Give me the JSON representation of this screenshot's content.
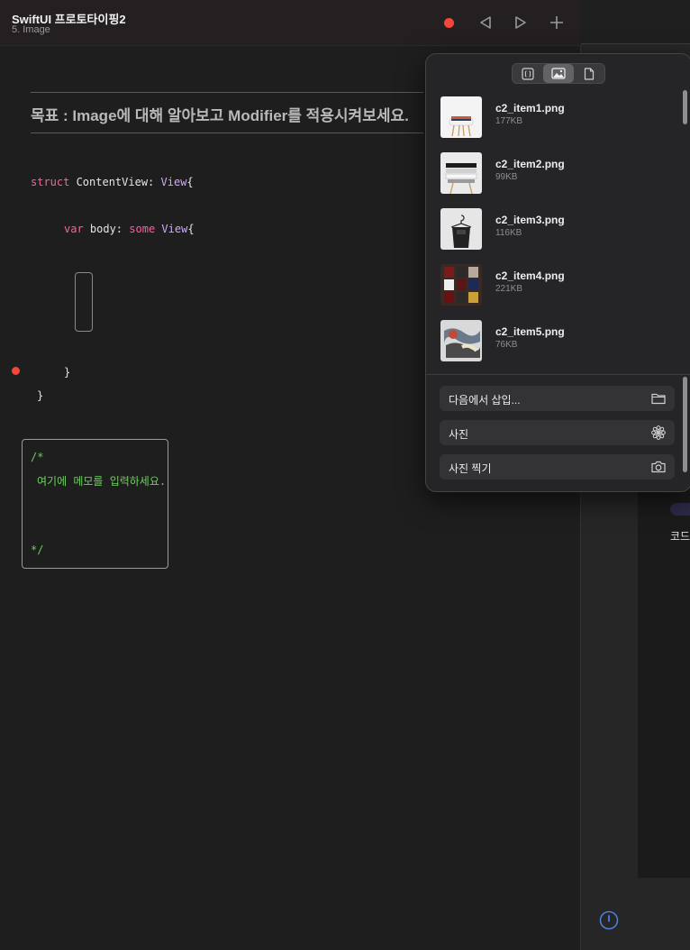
{
  "header": {
    "title": "SwiftUI 프로토타이핑2",
    "subtitle": "5. Image"
  },
  "editor": {
    "goal": "목표 : Image에 대해 알아보고 Modifier를 적용시켜보세요.",
    "code": {
      "line1": {
        "kw": "struct",
        "name": " ContentView: ",
        "type": "View",
        "brace": "{"
      },
      "line2": {
        "kw": "var",
        "name": " body: ",
        "kw2": "some",
        "sp": " ",
        "type": "View",
        "brace": "{"
      },
      "close_inner": "}",
      "close_outer": "}"
    },
    "memo": {
      "open": "/*",
      "text": "여기에 메모를 입력하세요.",
      "close": "*/"
    }
  },
  "popover": {
    "segments": [
      "code-icon",
      "photo-icon",
      "document-icon"
    ],
    "files": [
      {
        "name": "c2_item1.png",
        "size": "177KB"
      },
      {
        "name": "c2_item2.png",
        "size": "99KB"
      },
      {
        "name": "c2_item3.png",
        "size": "116KB"
      },
      {
        "name": "c2_item4.png",
        "size": "221KB"
      },
      {
        "name": "c2_item5.png",
        "size": "76KB"
      }
    ],
    "actions": [
      {
        "label": "다음에서 삽입...",
        "icon": "folder-icon"
      },
      {
        "label": "사진",
        "icon": "photos-flower-icon"
      },
      {
        "label": "사진 찍기",
        "icon": "camera-icon"
      }
    ]
  },
  "right_panel": {
    "text": "코드"
  },
  "colors": {
    "accent_red": "#f2473a",
    "keyword": "#fc5fa3",
    "type": "#d0a8ff",
    "comment": "#6ecf5f"
  }
}
